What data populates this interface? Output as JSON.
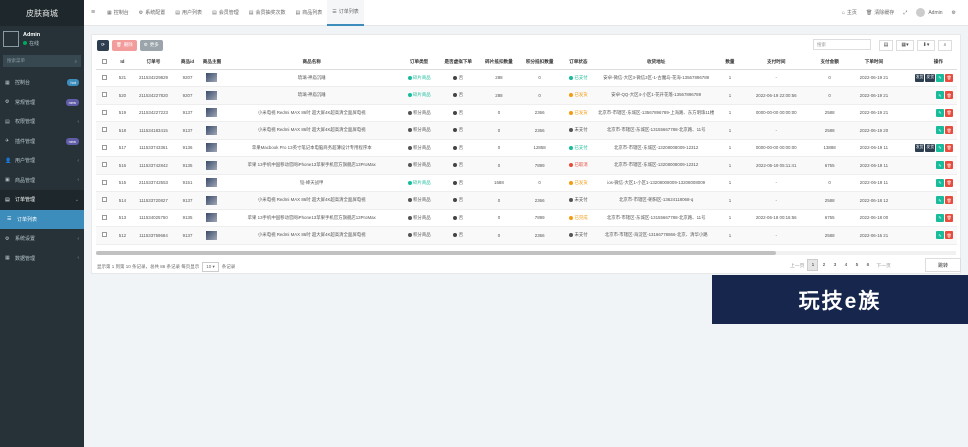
{
  "sidebar": {
    "brand": "皮肤商城",
    "user_name": "Admin",
    "user_status": "在线",
    "search_placeholder": "搜索菜单",
    "items": [
      {
        "icon": "dashboard-icon",
        "glyph": "▦",
        "label": "控制台",
        "badge": "hot",
        "badge_color": "#3c8dbc"
      },
      {
        "icon": "gear-icon",
        "glyph": "⚙",
        "label": "常规管理",
        "badge": "new",
        "badge_color": "#605ca8"
      },
      {
        "icon": "grid-icon",
        "glyph": "▤",
        "label": "权限管理",
        "badge": "",
        "arrow": "‹"
      },
      {
        "icon": "plugin-icon",
        "glyph": "✈",
        "label": "插件管理",
        "badge": "new",
        "badge_color": "#605ca8"
      },
      {
        "icon": "user-icon",
        "glyph": "👤",
        "label": "用户管理",
        "badge": "",
        "arrow": "‹"
      },
      {
        "icon": "goods-icon",
        "glyph": "▣",
        "label": "商品管理",
        "badge": "",
        "arrow": "‹"
      },
      {
        "icon": "order-icon",
        "glyph": "▤",
        "label": "订单管理",
        "badge": "",
        "arrow": "⌄"
      },
      {
        "icon": "list-icon",
        "glyph": "☰",
        "label": "订单列表",
        "badge": ""
      },
      {
        "icon": "settings-icon",
        "glyph": "⚙",
        "label": "系统设置",
        "badge": "",
        "arrow": "‹"
      },
      {
        "icon": "data-icon",
        "glyph": "▦",
        "label": "数据管理",
        "badge": "",
        "arrow": "‹"
      }
    ]
  },
  "topbar": {
    "tabs": [
      {
        "glyph": "▦",
        "label": "控制台"
      },
      {
        "glyph": "⚙",
        "label": "系统配置"
      },
      {
        "glyph": "▤",
        "label": "用户列表"
      },
      {
        "glyph": "▤",
        "label": "会员管理"
      },
      {
        "glyph": "▤",
        "label": "会员抽奖次数"
      },
      {
        "glyph": "▤",
        "label": "商品列表"
      },
      {
        "glyph": "☰",
        "label": "订单列表"
      }
    ],
    "right": {
      "home": "主页",
      "clear_cache": "清除缓存",
      "admin": "Admin"
    }
  },
  "toolbar": {
    "delete_label": "删除",
    "more_label": "更多",
    "search_placeholder": "搜索"
  },
  "table": {
    "columns": [
      "Id",
      "订单号",
      "商品id",
      "商品主图",
      "商品名称",
      "订单类型",
      "是否虚拟下单",
      "碎片抵扣数量",
      "积分抵扣数量",
      "订单状态",
      "收货地址",
      "数量",
      "支付时间",
      "支付金额",
      "下单时间",
      "操作"
    ],
    "rows": [
      {
        "id": "521",
        "order_no": "211534229829",
        "goods_id": "9207",
        "name": "琉璃-神庙沉睡",
        "type": "碎片商品",
        "type_color": "green",
        "virtual": "否",
        "frag": "288",
        "points": "0",
        "status": "已支付",
        "status_color": "green",
        "address": "安卓-微信-大区3-微信3区-1-古魔岛-花海-13567896789",
        "qty": "1",
        "pay_time": "-",
        "amount": "0",
        "order_time": "2022-06-19 21",
        "extra_ops": [
          "发货",
          "发货"
        ]
      },
      {
        "id": "520",
        "order_no": "211534227820",
        "goods_id": "9207",
        "name": "琉璃-神庙沉睡",
        "type": "碎片商品",
        "type_color": "green",
        "virtual": "否",
        "frag": "288",
        "points": "0",
        "status": "已发货",
        "status_color": "orange",
        "address": "安卓-QQ-大区4-小区1-花开花落-13567896789",
        "qty": "1",
        "pay_time": "2022-06-19 22:00:56",
        "amount": "0",
        "order_time": "2022-06-19 21",
        "extra_ops": []
      },
      {
        "id": "519",
        "order_no": "211534227223",
        "goods_id": "9137",
        "name": "小米电视 Redmi MAX 86吋 超大屏4K超高清全面屏电视",
        "type": "积分商品",
        "type_color": "gray",
        "virtual": "否",
        "frag": "0",
        "points": "2366",
        "status": "已发货",
        "status_color": "orange",
        "address": "北京市-市辖区-东城区-13567896789-上海路、东方明珠11楼",
        "qty": "1",
        "pay_time": "0000-00-00 00:00:00",
        "amount": "2588",
        "order_time": "2022-06-19 21",
        "extra_ops": []
      },
      {
        "id": "518",
        "order_no": "111534183415",
        "goods_id": "9137",
        "name": "小米电视 Redmi MAX 86吋 超大屏4K超高清全面屏电视",
        "type": "积分商品",
        "type_color": "gray",
        "virtual": "否",
        "frag": "0",
        "points": "2366",
        "status": "未支付",
        "status_color": "gray",
        "address": "北京市-市辖区-东城区-13155667788-北京路、11号",
        "qty": "1",
        "pay_time": "-",
        "amount": "2588",
        "order_time": "2022-06-19 20",
        "extra_ops": []
      },
      {
        "id": "517",
        "order_no": "111533743361",
        "goods_id": "9136",
        "name": "苹果Macbook Pro 13英寸笔记本电脑商务超薄设计专用程序本",
        "type": "积分商品",
        "type_color": "gray",
        "virtual": "否",
        "frag": "0",
        "points": "12858",
        "status": "已支付",
        "status_color": "green",
        "address": "北京市-市辖区-东城区-13208008009-12312",
        "qty": "1",
        "pay_time": "0000-00-00 00:00:00",
        "amount": "13888",
        "order_time": "2022-06-19 11",
        "extra_ops": [
          "发货",
          "发货"
        ]
      },
      {
        "id": "516",
        "order_no": "111533742842",
        "goods_id": "9135",
        "name": "苹果 13手机中国移动官网iPhone13苹果手机官方旗舰店13ProMax",
        "type": "积分商品",
        "type_color": "gray",
        "virtual": "否",
        "frag": "0",
        "points": "7899",
        "status": "已取消",
        "status_color": "red",
        "address": "北京市-市辖区-东城区-13208008009-12312",
        "qty": "1",
        "pay_time": "2022-06-19 05:11:41",
        "amount": "6755",
        "order_time": "2022-06-19 11",
        "extra_ops": []
      },
      {
        "id": "515",
        "order_no": "211533742553",
        "goods_id": "9151",
        "name": "铠-绛天战甲",
        "type": "碎片商品",
        "type_color": "green",
        "virtual": "否",
        "frag": "1688",
        "points": "0",
        "status": "已发货",
        "status_color": "orange",
        "address": "ios-微信-大区1-小区1-13208008009-13208008009",
        "qty": "1",
        "pay_time": "-",
        "amount": "0",
        "order_time": "2022-06-19 11",
        "extra_ops": []
      },
      {
        "id": "514",
        "order_no": "111533720827",
        "goods_id": "9137",
        "name": "小米电视 Redmi MAX 86吋 超大屏4K超高清全面屏电视",
        "type": "积分商品",
        "type_color": "gray",
        "virtual": "否",
        "frag": "0",
        "points": "2366",
        "status": "未支付",
        "status_color": "gray",
        "address": "北京市-市辖区-朝阳区-13624118068-q",
        "qty": "1",
        "pay_time": "-",
        "amount": "2588",
        "order_time": "2022-06-18 12",
        "extra_ops": []
      },
      {
        "id": "513",
        "order_no": "111534025750",
        "goods_id": "9135",
        "name": "苹果 13手机中国移动官网iPhone13苹果手机官方旗舰店13ProMax",
        "type": "积分商品",
        "type_color": "gray",
        "virtual": "否",
        "frag": "0",
        "points": "7899",
        "status": "已完成",
        "status_color": "orange",
        "address": "北京市-市辖区-东城区-13155667788-北京路、11号",
        "qty": "1",
        "pay_time": "2022-06-18 00:16:56",
        "amount": "6755",
        "order_time": "2022-06-18 00",
        "extra_ops": []
      },
      {
        "id": "512",
        "order_no": "111533759684",
        "goods_id": "9137",
        "name": "小米电视 Redmi MAX 86吋 超大屏4K超高清全面屏电视",
        "type": "积分商品",
        "type_color": "gray",
        "virtual": "否",
        "frag": "0",
        "points": "2366",
        "status": "未支付",
        "status_color": "gray",
        "address": "北京市-市辖区-海淀区-13166778866-北京、清华小路",
        "qty": "1",
        "pay_time": "-",
        "amount": "2588",
        "order_time": "2022-06-16 21",
        "extra_ops": []
      }
    ]
  },
  "footer": {
    "summary": "显示第 1 到第 10 条记录，总共 86 条记录 每页显示",
    "page_size": "10 ▾",
    "summary_suffix": "条记录"
  },
  "pager": {
    "prev": "上一页",
    "pages": [
      "1",
      "2",
      "3",
      "4",
      "5",
      "6"
    ],
    "active": "1",
    "next": "下一页",
    "jump": "跳转"
  },
  "watermark": "玩技e族",
  "colors": {
    "green": "#18bc9c",
    "orange": "#f39c12",
    "red": "#e74c3c",
    "gray": "#555555",
    "sidebar": "#263238",
    "accent": "#3c8dbc"
  }
}
